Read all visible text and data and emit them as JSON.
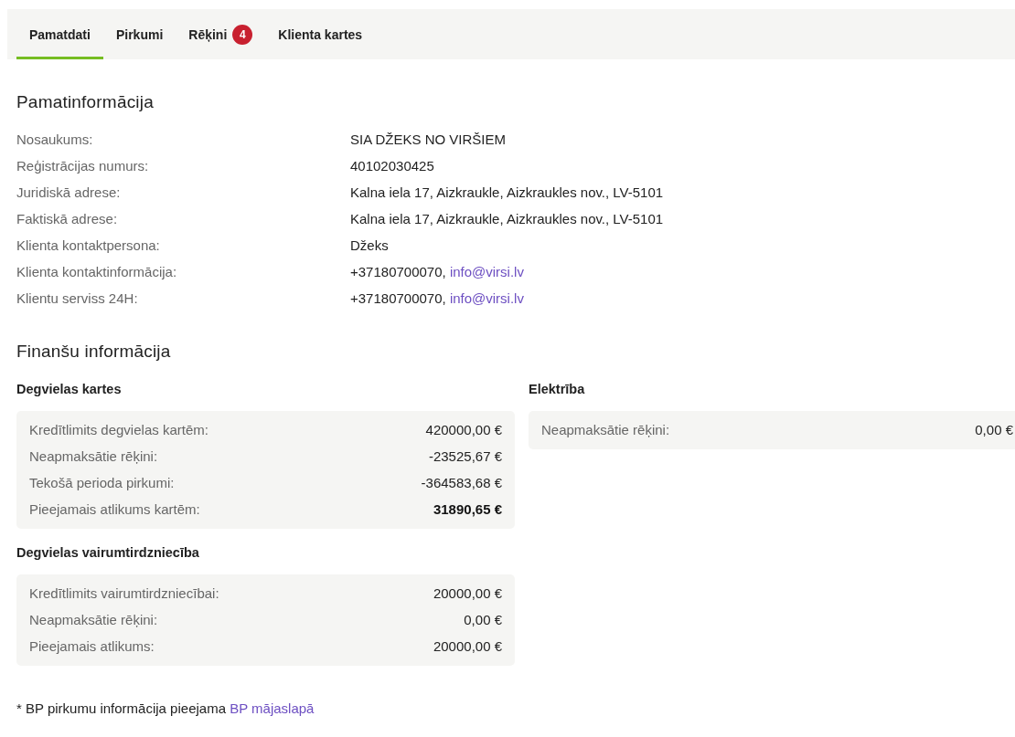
{
  "tabs": [
    {
      "label": "Pamatdati",
      "selected": true
    },
    {
      "label": "Pirkumi",
      "selected": false
    },
    {
      "label": "Rēķini",
      "selected": false,
      "badge": "4"
    },
    {
      "label": "Klienta kartes",
      "selected": false
    }
  ],
  "basic_info": {
    "title": "Pamatinformācija",
    "rows": [
      {
        "label": "Nosaukums:",
        "value": "SIA DŽEKS NO VIRŠIEM"
      },
      {
        "label": "Reģistrācijas numurs:",
        "value": "40102030425"
      },
      {
        "label": "Juridiskā adrese:",
        "value": "Kalna iela 17, Aizkraukle, Aizkraukles nov., LV-5101"
      },
      {
        "label": "Faktiskā adrese:",
        "value": "Kalna iela 17, Aizkraukle, Aizkraukles nov., LV-5101"
      },
      {
        "label": "Klienta kontaktpersona:",
        "value": "Džeks"
      },
      {
        "label": "Klienta kontaktinformācija:",
        "value": "+37180700070, ",
        "link": "info@virsi.lv"
      },
      {
        "label": "Klientu serviss 24H:",
        "value": "+37180700070, ",
        "link": "info@virsi.lv"
      }
    ]
  },
  "finance": {
    "title": "Finanšu informācija",
    "columns": [
      [
        {
          "title": "Degvielas kartes",
          "rows": [
            {
              "label": "Kredītlimits degvielas kartēm:",
              "value": "420000,00 €",
              "bold": false
            },
            {
              "label": "Neapmaksātie rēķini:",
              "value": "-23525,67 €",
              "bold": false
            },
            {
              "label": "Tekošā perioda pirkumi:",
              "value": "-364583,68 €",
              "bold": false
            },
            {
              "label": "Pieejamais atlikums kartēm:",
              "value": "31890,65 €",
              "bold": true
            }
          ]
        },
        {
          "title": "Degvielas vairumtirdzniecība",
          "rows": [
            {
              "label": "Kredītlimits vairumtirdzniecībai:",
              "value": "20000,00 €",
              "bold": false
            },
            {
              "label": "Neapmaksātie rēķini:",
              "value": "0,00 €",
              "bold": false
            },
            {
              "label": "Pieejamais atlikums:",
              "value": "20000,00 €",
              "bold": false
            }
          ]
        }
      ],
      [
        {
          "title": "Elektrība",
          "rows": [
            {
              "label": "Neapmaksātie rēķini:",
              "value": "0,00 €",
              "bold": false
            }
          ]
        }
      ]
    ]
  },
  "footnote": {
    "text": "* BP pirkumu informācija pieejama ",
    "link": "BP mājaslapā"
  }
}
